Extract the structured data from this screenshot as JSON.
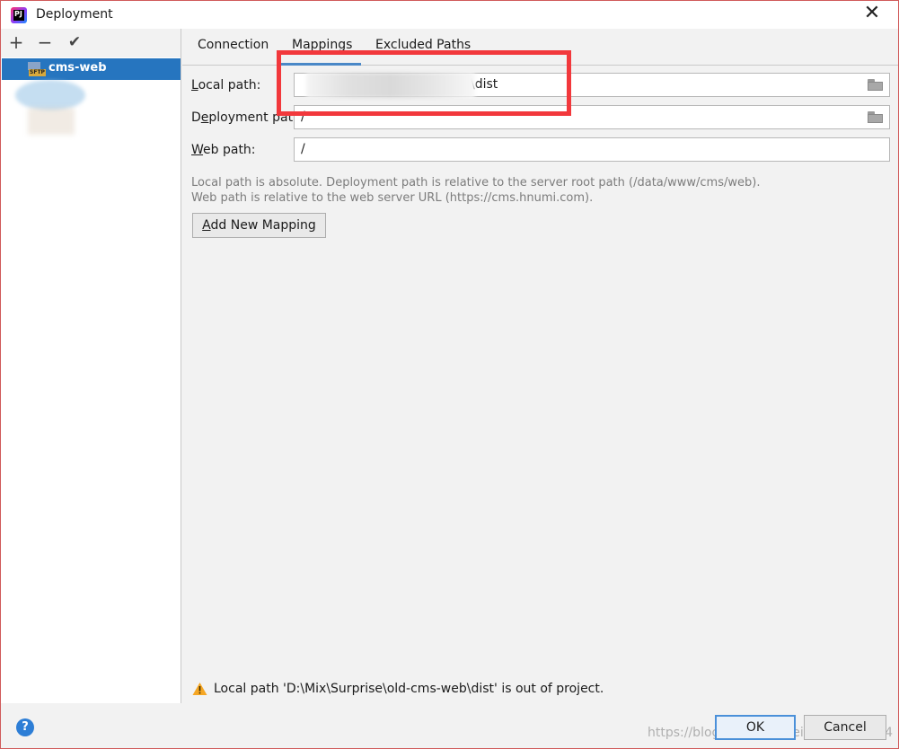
{
  "window": {
    "title": "Deployment",
    "close_label": "✕"
  },
  "sidebar": {
    "toolbar": {
      "add": "+",
      "remove": "−",
      "apply": "✔"
    },
    "server": {
      "badge": "SFTP",
      "name": "cms-web"
    }
  },
  "tabs": [
    {
      "label": "Connection"
    },
    {
      "label": "Mappings"
    },
    {
      "label": "Excluded Paths"
    }
  ],
  "fields": {
    "local_path": {
      "label_mnemonic": "L",
      "label_rest": "ocal path:",
      "value": "\\dist"
    },
    "deployment_path": {
      "label_first": "D",
      "label_mnemonic": "e",
      "label_rest": "ployment path:",
      "value": "/"
    },
    "web_path": {
      "label_mnemonic": "W",
      "label_rest": "eb path:",
      "value": "/"
    }
  },
  "help": {
    "line1": "Local path is absolute. Deployment path is relative to the server root path (/data/www/cms/web).",
    "line2": "Web path is relative to the web server URL (https://cms.hnumi.com)."
  },
  "add_mapping": {
    "mnemonic": "A",
    "rest": "dd New Mapping"
  },
  "warning": {
    "text": "Local path 'D:\\Mix\\Surprise\\old-cms-web\\dist' is out of project."
  },
  "footer": {
    "help_label": "?",
    "ok": "OK",
    "cancel": "Cancel",
    "watermark": "https://blog.csdn.net/weixin_42181264"
  },
  "colors": {
    "selection": "#2675bf",
    "tab_underline": "#4a88c7",
    "highlight_frame": "#f2383c",
    "warning": "#f5a623",
    "help_icon": "#2d7ed6"
  }
}
